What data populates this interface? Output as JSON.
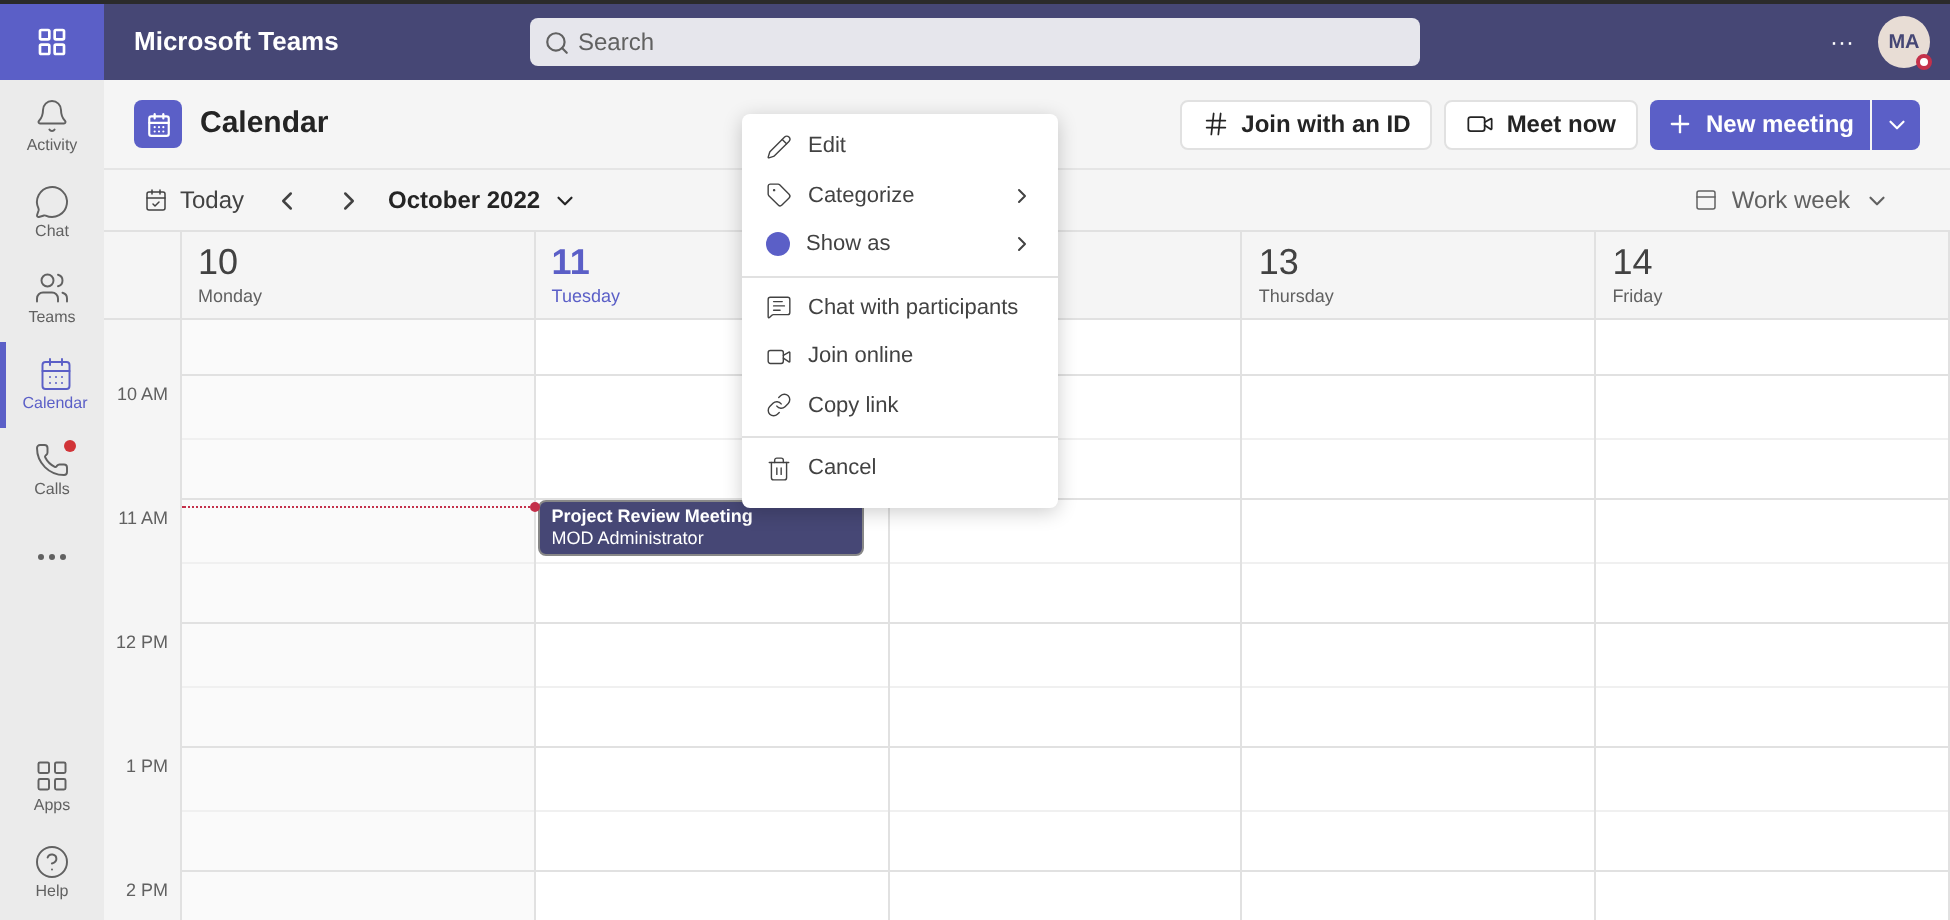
{
  "app": {
    "title": "Microsoft Teams",
    "search": {
      "placeholder": "Search"
    },
    "more": "···",
    "avatar": {
      "initials": "MA"
    }
  },
  "sidebar": {
    "items": [
      {
        "kind": "activity",
        "label": "Activity",
        "selected": false,
        "badge": false
      },
      {
        "kind": "chat",
        "label": "Chat",
        "selected": false,
        "badge": false
      },
      {
        "kind": "teams",
        "label": "Teams",
        "selected": false,
        "badge": false
      },
      {
        "kind": "calendar",
        "label": "Calendar",
        "selected": true,
        "badge": false
      },
      {
        "kind": "calls",
        "label": "Calls",
        "selected": false,
        "badge": true
      },
      {
        "kind": "more",
        "selected": false,
        "badge": false
      }
    ],
    "bottom": [
      {
        "kind": "apps",
        "label": "Apps"
      },
      {
        "kind": "help",
        "label": "Help"
      }
    ]
  },
  "header": {
    "title": "Calendar",
    "buttons": [
      {
        "kind": "id",
        "label": "Join with an ID"
      },
      {
        "kind": "video",
        "label": "Meet now"
      }
    ],
    "primary": {
      "label": "New meeting"
    }
  },
  "toolbar": {
    "today": "Today",
    "month": "October 2022",
    "view": "Work week"
  },
  "days": [
    {
      "date": "10",
      "weekday": "Monday",
      "selected": false
    },
    {
      "date": "11",
      "weekday": "Tuesday",
      "selected": true
    },
    {
      "covered": true
    },
    {
      "date": "13",
      "weekday": "Thursday",
      "selected": false
    },
    {
      "date": "14",
      "weekday": "Friday",
      "selected": false
    }
  ],
  "times": [
    "10 AM",
    "11 AM",
    "12 PM",
    "1 PM",
    "2 PM"
  ],
  "event": {
    "title": "Project Review Meeting",
    "organizer": "MOD Administrator"
  },
  "context_menu": {
    "groups": [
      [
        {
          "kind": "edit",
          "label": "Edit",
          "submenu": false
        },
        {
          "kind": "tag",
          "label": "Categorize",
          "submenu": true
        },
        {
          "kind": "status",
          "label": "Show as",
          "submenu": true,
          "color": "#5b5fc7"
        }
      ],
      [
        {
          "kind": "chat",
          "label": "Chat with participants",
          "submenu": false
        },
        {
          "kind": "video",
          "label": "Join online",
          "submenu": false
        },
        {
          "kind": "link",
          "label": "Copy link",
          "submenu": false
        }
      ],
      [
        {
          "kind": "trash",
          "label": "Cancel",
          "submenu": false
        }
      ]
    ]
  }
}
